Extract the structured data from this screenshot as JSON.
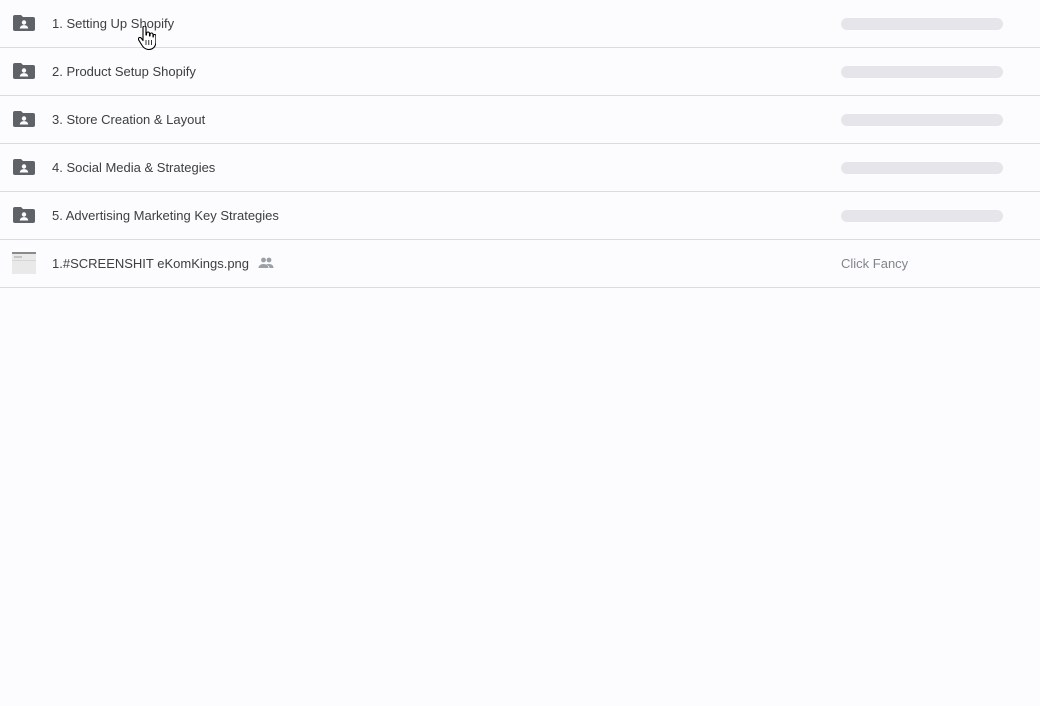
{
  "files": [
    {
      "name": "1. Setting Up Shopify",
      "type": "shared-folder",
      "owner_loading": true
    },
    {
      "name": "2. Product Setup Shopify",
      "type": "shared-folder",
      "owner_loading": true
    },
    {
      "name": "3. Store Creation & Layout",
      "type": "shared-folder",
      "owner_loading": true
    },
    {
      "name": "4. Social Media & Strategies",
      "type": "shared-folder",
      "owner_loading": true
    },
    {
      "name": "5. Advertising Marketing Key Strategies",
      "type": "shared-folder",
      "owner_loading": true
    },
    {
      "name": "1.#SCREENSHIT  eKomKings.png",
      "type": "image",
      "shared": true,
      "owner": "Click Fancy"
    }
  ],
  "icons": {
    "folder": "shared-folder-icon",
    "image": "image-thumbnail",
    "shared": "people-icon",
    "cursor": "hand-pointer-cursor"
  },
  "colors": {
    "background": "#fcfbfd",
    "text": "#3c4043",
    "secondary_text": "#80868b",
    "icon": "#5f6368",
    "placeholder": "#e6e5ea",
    "divider": "#dadce0"
  }
}
